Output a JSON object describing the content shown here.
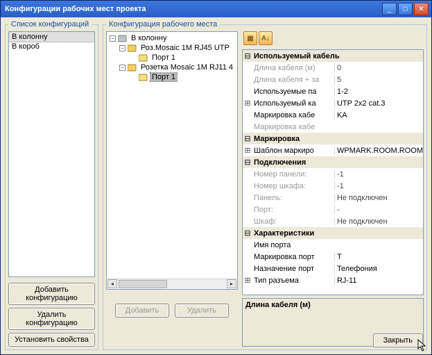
{
  "window": {
    "title": "Конфигурации рабочих мест проекта"
  },
  "left": {
    "legend": "Список конфигураций",
    "items": [
      "В колонну",
      "В короб"
    ],
    "selected_index": 0,
    "btn_add": "Добавить конфигурацию",
    "btn_del": "Удалить конфигурацию",
    "btn_set": "Установить свойства"
  },
  "right": {
    "legend": "Конфигурация рабочего места",
    "tree": {
      "root": "В колонну",
      "nodes": [
        {
          "label": "Роз.Mosaic 1M RJ45 UTP",
          "port": "Порт 1"
        },
        {
          "label": "Розетка Mosaic 1M RJ11 4",
          "port": "Порт 1",
          "port_selected": true
        }
      ],
      "btn_add": "Добавить",
      "btn_del": "Удалить"
    },
    "props": {
      "categories": [
        {
          "name": "Используемый кабель",
          "rows": [
            {
              "name": "Длина кабеля (м)",
              "val": "0",
              "gray": true
            },
            {
              "name": "Длина кабеля + за",
              "val": "5",
              "gray": true
            },
            {
              "name": "Используемые па",
              "val": "1-2",
              "exp": ""
            },
            {
              "name": "Используемый ка",
              "val": "UTP 2x2 cat.3",
              "exp": "+"
            },
            {
              "name": "Маркировка кабе",
              "val": "KA"
            },
            {
              "name": "Маркировка кабе",
              "val": "",
              "gray": true
            }
          ]
        },
        {
          "name": "Маркировка",
          "rows": [
            {
              "name": "Шаблон маркиро",
              "val": "WPMARK.ROOM.ROOM",
              "exp": "+"
            }
          ]
        },
        {
          "name": "Подключения",
          "rows": [
            {
              "name": "Номер панели:",
              "val": "-1",
              "gray": true
            },
            {
              "name": "Номер шкафа:",
              "val": "-1",
              "gray": true
            },
            {
              "name": "Панель:",
              "val": "Не подключен",
              "gray": true
            },
            {
              "name": "Порт:",
              "val": "-",
              "gray": true
            },
            {
              "name": "Шкаф:",
              "val": "Не подключен",
              "gray": true
            }
          ]
        },
        {
          "name": "Характеристики",
          "rows": [
            {
              "name": "Имя порта",
              "val": ""
            },
            {
              "name": "Маркировка порт",
              "val": "T"
            },
            {
              "name": "Назначение порт",
              "val": "Телефония"
            },
            {
              "name": "Тип разъема",
              "val": "RJ-11",
              "exp": "+"
            }
          ]
        }
      ],
      "desc": "Длина кабеля (м)"
    }
  },
  "footer": {
    "close": "Закрыть"
  }
}
